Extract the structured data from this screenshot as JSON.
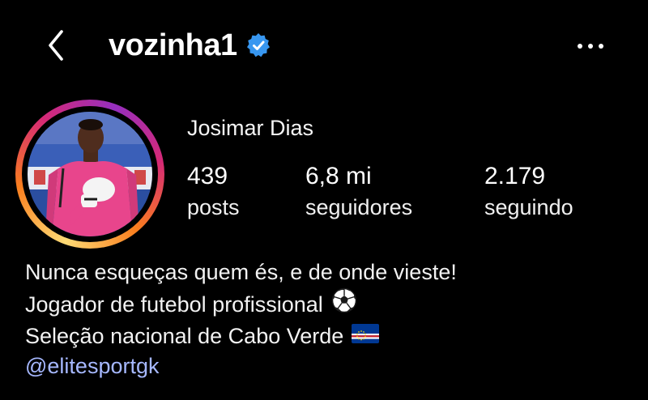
{
  "header": {
    "username": "vozinha1",
    "back_icon": "chevron-left-icon",
    "verified_icon": "verified-badge-icon",
    "more_icon": "more-horizontal-icon"
  },
  "profile": {
    "display_name": "Josimar Dias",
    "avatar": "profile-photo",
    "story_ring_colors": [
      "#feda75",
      "#fa7e1e",
      "#d62976",
      "#962fbf"
    ],
    "stats": {
      "posts": {
        "value": "439",
        "label": "posts"
      },
      "followers": {
        "value": "6,8 mi",
        "label": "seguidores"
      },
      "following": {
        "value": "2.179",
        "label": "seguindo"
      }
    },
    "bio": {
      "line1": "Nunca esqueças quem és, e de onde vieste!",
      "line2": "Jogador de futebol profissional",
      "line2_icon": "soccer-ball-icon",
      "line3": "Seleção nacional de Cabo Verde",
      "line3_icon": "cape-verde-flag-icon",
      "link": "@elitesportgk"
    }
  },
  "colors": {
    "background": "#000000",
    "verified": "#3897f0",
    "link": "#a6b8ff"
  }
}
